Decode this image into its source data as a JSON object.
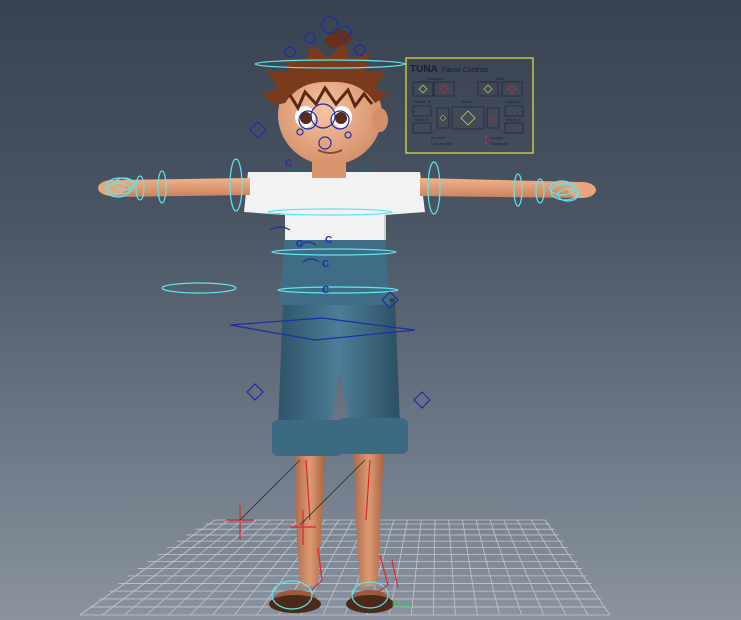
{
  "colors": {
    "viewport_top": "#384250",
    "viewport_bottom": "#8a939f",
    "grid": "#c8cdd4",
    "rig_control_cyan": "#5ee6ee",
    "rig_control_blue": "#1a2fa8",
    "rig_joint_red": "#e0262a",
    "panel_border": "#e6e24a",
    "skin": "#e8a57e",
    "hair": "#7a3a1c",
    "shirt": "#f2f2f2",
    "denim": "#3f6d86"
  },
  "icons": [
    "control-curve",
    "ik-handle",
    "joint",
    "facial-control-box"
  ],
  "facial_panel": {
    "logo": "TUNA",
    "title": "Facial Controls",
    "labels": {
      "eyebrows": "Eyebrows",
      "eyes": "Eyes",
      "cheek_left": "Cheek_R",
      "cheek_right": "Cheek_L",
      "mouth": "Mouth",
      "nose": "Nose_R",
      "mouth_left": "Mouth_L",
      "mouth_right": "Mouth_R"
    },
    "footer_left_top": "Un Lexbr",
    "footer_left_bottom": "Lnxp Hp Blnk",
    "footer_right_top": "Lnpxgvh",
    "footer_right_bottom": "Tonguecntrl"
  },
  "ground_label": "Body",
  "rig_letter": "C"
}
